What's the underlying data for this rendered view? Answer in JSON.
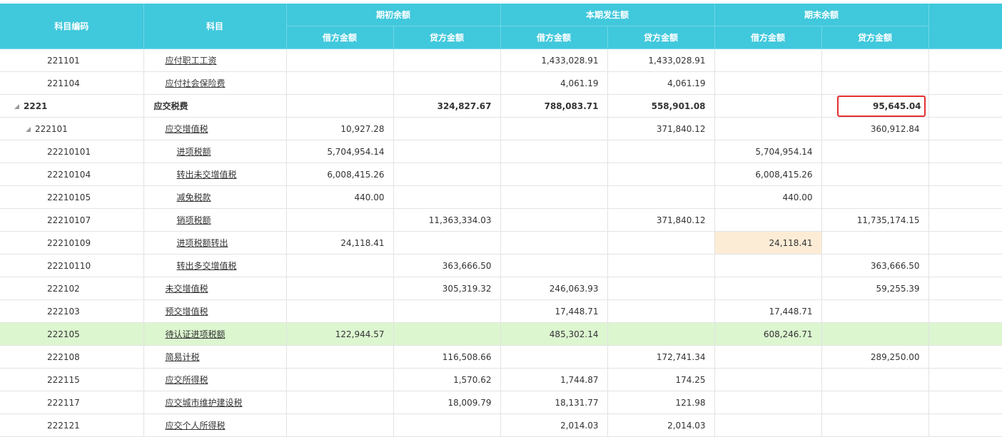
{
  "header": {
    "code": "科目编码",
    "name": "科目",
    "group_opening": "期初余额",
    "group_period": "本期发生额",
    "group_closing": "期末余额",
    "debit": "借方金额",
    "credit": "贷方金额"
  },
  "rows": [
    {
      "code": "221101",
      "name": "应付职工工资",
      "od": "",
      "oc": "",
      "pd": "1,433,028.91",
      "pc": "1,433,028.91",
      "cd": "",
      "cc": ""
    },
    {
      "code": "221104",
      "name": "应付社会保险费",
      "od": "",
      "oc": "",
      "pd": "4,061.19",
      "pc": "4,061.19",
      "cd": "",
      "cc": ""
    },
    {
      "code": "2221",
      "name": "应交税费",
      "od": "",
      "oc": "324,827.67",
      "pd": "788,083.71",
      "pc": "558,901.08",
      "cd": "",
      "cc": "95,645.04"
    },
    {
      "code": "222101",
      "name": "应交增值税",
      "od": "10,927.28",
      "oc": "",
      "pd": "",
      "pc": "371,840.12",
      "cd": "",
      "cc": "360,912.84"
    },
    {
      "code": "22210101",
      "name": "进项税额",
      "od": "5,704,954.14",
      "oc": "",
      "pd": "",
      "pc": "",
      "cd": "5,704,954.14",
      "cc": ""
    },
    {
      "code": "22210104",
      "name": "转出未交增值税",
      "od": "6,008,415.26",
      "oc": "",
      "pd": "",
      "pc": "",
      "cd": "6,008,415.26",
      "cc": ""
    },
    {
      "code": "22210105",
      "name": "减免税款",
      "od": "440.00",
      "oc": "",
      "pd": "",
      "pc": "",
      "cd": "440.00",
      "cc": ""
    },
    {
      "code": "22210107",
      "name": "销项税额",
      "od": "",
      "oc": "11,363,334.03",
      "pd": "",
      "pc": "371,840.12",
      "cd": "",
      "cc": "11,735,174.15"
    },
    {
      "code": "22210109",
      "name": "进项税额转出",
      "od": "24,118.41",
      "oc": "",
      "pd": "",
      "pc": "",
      "cd": "24,118.41",
      "cc": ""
    },
    {
      "code": "22210110",
      "name": "转出多交增值税",
      "od": "",
      "oc": "363,666.50",
      "pd": "",
      "pc": "",
      "cd": "",
      "cc": "363,666.50"
    },
    {
      "code": "222102",
      "name": "未交增值税",
      "od": "",
      "oc": "305,319.32",
      "pd": "246,063.93",
      "pc": "",
      "cd": "",
      "cc": "59,255.39"
    },
    {
      "code": "222103",
      "name": "预交增值税",
      "od": "",
      "oc": "",
      "pd": "17,448.71",
      "pc": "",
      "cd": "17,448.71",
      "cc": ""
    },
    {
      "code": "222105",
      "name": "待认证进项税额",
      "od": "122,944.57",
      "oc": "",
      "pd": "485,302.14",
      "pc": "",
      "cd": "608,246.71",
      "cc": ""
    },
    {
      "code": "222108",
      "name": "简易计税",
      "od": "",
      "oc": "116,508.66",
      "pd": "",
      "pc": "172,741.34",
      "cd": "",
      "cc": "289,250.00"
    },
    {
      "code": "222115",
      "name": "应交所得税",
      "od": "",
      "oc": "1,570.62",
      "pd": "1,744.87",
      "pc": "174.25",
      "cd": "",
      "cc": ""
    },
    {
      "code": "222117",
      "name": "应交城市维护建设税",
      "od": "",
      "oc": "18,009.79",
      "pd": "18,131.77",
      "pc": "121.98",
      "cd": "",
      "cc": ""
    },
    {
      "code": "222121",
      "name": "应交个人所得税",
      "od": "",
      "oc": "",
      "pd": "2,014.03",
      "pc": "2,014.03",
      "cd": "",
      "cc": ""
    }
  ],
  "row_level": [
    1,
    1,
    0,
    1,
    2,
    2,
    2,
    2,
    2,
    2,
    1,
    1,
    1,
    1,
    1,
    1,
    1
  ],
  "expanded_nodes": [
    "2221",
    "222101"
  ],
  "highlighted_row": "222105",
  "highlighted_cell": "22210109 期末借方",
  "boxed_cell": "2221 期末贷方",
  "colors": {
    "header": "#40c8dc",
    "row_highlight": "#dcf6d0",
    "cell_highlight": "#fdecd5",
    "box": "#e53030"
  }
}
